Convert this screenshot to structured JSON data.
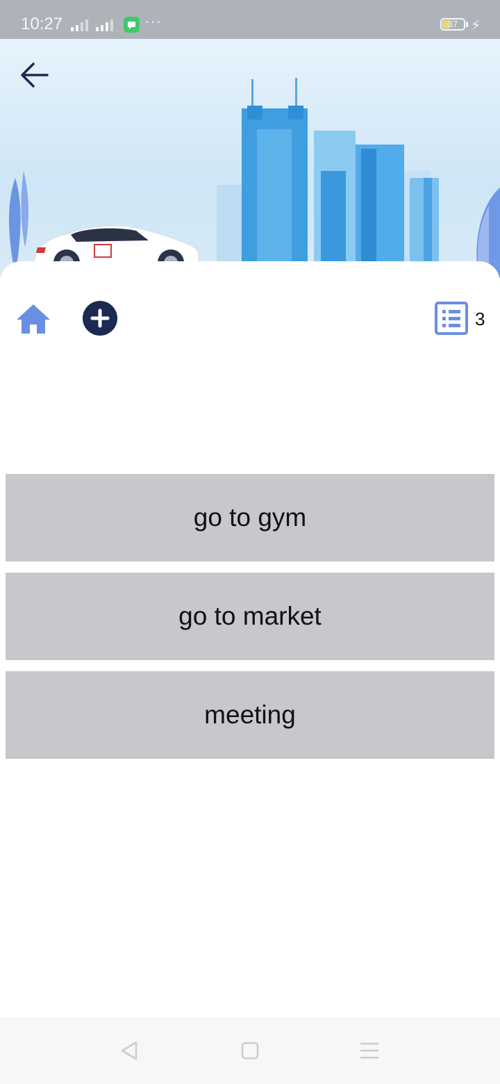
{
  "status_bar": {
    "time": "10:27",
    "battery_level": "37",
    "dots": "···"
  },
  "header": {
    "back_icon": "arrow-left-icon",
    "illustration": "city-skyline-with-car"
  },
  "toolbar": {
    "home_icon": "home-icon",
    "add_icon": "plus-circle-icon",
    "list_icon": "list-icon",
    "list_count": "3"
  },
  "tasks": [
    {
      "label": "go to gym"
    },
    {
      "label": "go to market"
    },
    {
      "label": "meeting"
    }
  ],
  "nav_bar": {
    "back_icon": "nav-back-icon",
    "home_icon": "nav-home-icon",
    "menu_icon": "nav-menu-icon"
  },
  "colors": {
    "accent": "#1c2a52",
    "icon_blue": "#6b8fe0",
    "task_bg": "#c7c8cc"
  }
}
